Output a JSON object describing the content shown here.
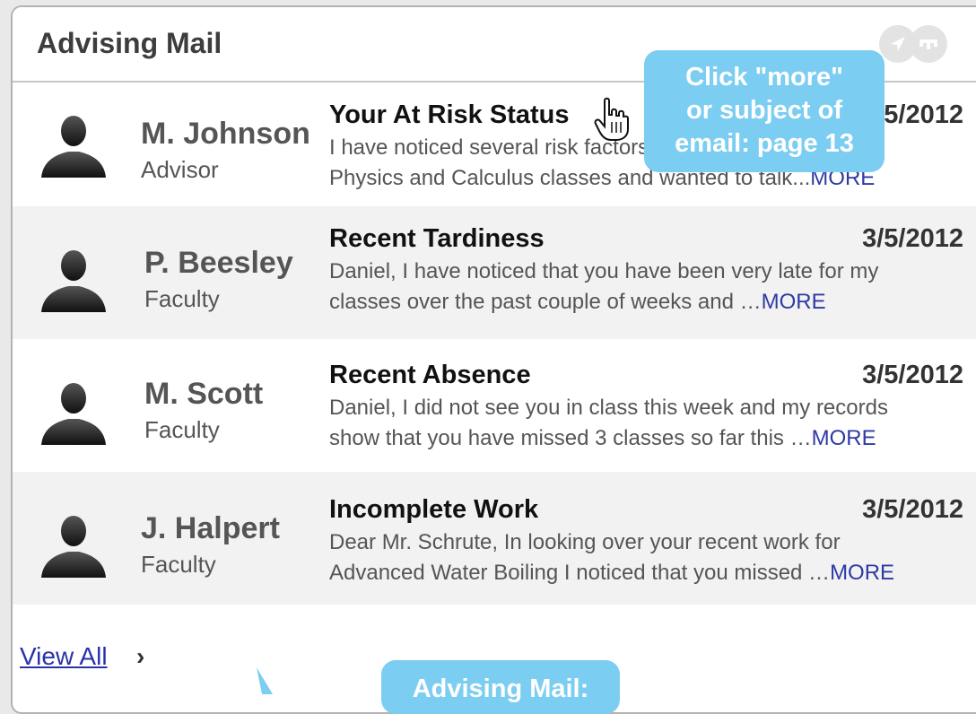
{
  "header": {
    "title": "Advising Mail",
    "icons": [
      "compass-icon",
      "phone-icon"
    ]
  },
  "messages": [
    {
      "sender": "M. Johnson",
      "role": "Advisor",
      "subject": "Your At Risk Status",
      "date": "3/5/2012",
      "preview_line1": "I have noticed several risk factors in your",
      "preview_line2": "Physics and Calculus classes and wanted to talk...",
      "more": "MORE"
    },
    {
      "sender": "P. Beesley",
      "role": "Faculty",
      "subject": "Recent Tardiness",
      "date": "3/5/2012",
      "preview_line1": "Daniel, I have noticed that you have been very late for my",
      "preview_line2": "classes over the past couple of weeks and …",
      "more": "MORE"
    },
    {
      "sender": "M. Scott",
      "role": "Faculty",
      "subject": "Recent Absence",
      "date": "3/5/2012",
      "preview_line1": "Daniel, I did not see you in class this week and my records",
      "preview_line2": "show that you have missed 3 classes so far this …",
      "more": "MORE"
    },
    {
      "sender": "J. Halpert",
      "role": "Faculty",
      "subject": "Incomplete Work",
      "date": "3/5/2012",
      "preview_line1": "Dear Mr. Schrute, In looking over your recent work for",
      "preview_line2": "Advanced Water Boiling I noticed that you missed …",
      "more": "MORE"
    }
  ],
  "footer": {
    "view_all": "View All",
    "chevron": "›"
  },
  "annotations": {
    "callout_top": [
      "Click \"more\"",
      "or subject of",
      "email: page 13"
    ],
    "callout_bottom": "Advising Mail:"
  },
  "colors": {
    "callout": "#7ccdf2",
    "link": "#2e3aa3",
    "row_shade": "#f2f2f2"
  }
}
